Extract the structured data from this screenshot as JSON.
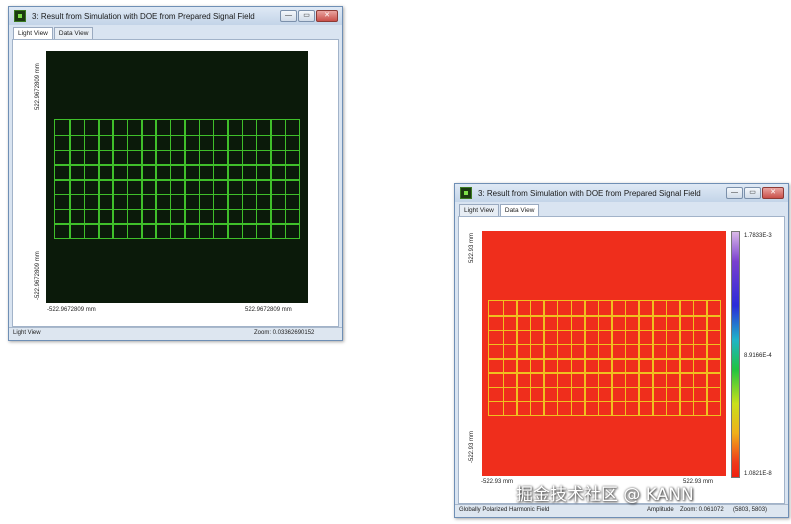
{
  "window_left": {
    "title": "3: Result from Simulation with DOE from Prepared Signal Field",
    "controls": {
      "minimize": "—",
      "restore": "▭",
      "close": "✕"
    },
    "tabs": [
      {
        "label": "Light View",
        "active": true
      },
      {
        "label": "Data View",
        "active": false
      }
    ],
    "y_max_label": "522.9672809 mm",
    "y_min_label": "-522.9672809 mm",
    "x_min_label": "-522.9672809 mm",
    "x_max_label": "522.9672809 mm",
    "status_left": "Light View",
    "status_right": "Zoom: 0.03362690152",
    "colors": {
      "background": "#0b1a0a",
      "pattern": "#3fbf2a"
    },
    "pattern": {
      "columns": 17,
      "rows": 8
    }
  },
  "window_right": {
    "title": "3: Result from Simulation with DOE from Prepared Signal Field",
    "controls": {
      "minimize": "—",
      "restore": "▭",
      "close": "✕"
    },
    "tabs": [
      {
        "label": "Light View",
        "active": false
      },
      {
        "label": "Data View",
        "active": true
      }
    ],
    "y_max_label": "522.93 mm",
    "y_min_label": "-522.93 mm",
    "x_min_label": "-522.93 mm",
    "x_max_label": "522.93 mm",
    "colorbar": {
      "max_label": "1.7833E-3",
      "mid_label": "8.9166E-4",
      "min_label": "1.0821E-8"
    },
    "status_left": "Globally Polarized Harmonic Field",
    "status_mid": "Amplitude",
    "status_right": "Zoom: 0.061072",
    "status_extra": "(5803, 5803)",
    "colors": {
      "background": "#ef2e1c",
      "pattern": "#f0c020"
    },
    "pattern": {
      "columns": 17,
      "rows": 8
    }
  },
  "watermark": "掘金技术社区 @ KANN"
}
